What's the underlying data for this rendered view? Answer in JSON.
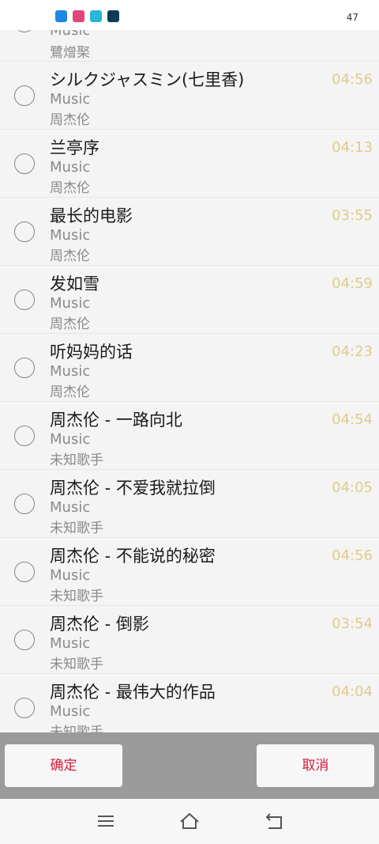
{
  "status_bar": {
    "time": "47",
    "app_icons": [
      {
        "name": "app-blue-arrow",
        "color": "#1e88e5"
      },
      {
        "name": "app-pink",
        "color": "#e0457b"
      },
      {
        "name": "app-cyan",
        "color": "#29b6d8"
      },
      {
        "name": "app-dark-teal",
        "color": "#0d3b57"
      }
    ]
  },
  "songs": [
    {
      "title": "",
      "source": "Music",
      "artist": "鷺熷棸",
      "duration": ""
    },
    {
      "title": "シルクジャスミン(七里香)",
      "source": "Music",
      "artist": "周杰伦",
      "duration": "04:56"
    },
    {
      "title": "兰亭序",
      "source": "Music",
      "artist": "周杰伦",
      "duration": "04:13"
    },
    {
      "title": "最长的电影",
      "source": "Music",
      "artist": "周杰伦",
      "duration": "03:55"
    },
    {
      "title": "发如雪",
      "source": "Music",
      "artist": "周杰伦",
      "duration": "04:59"
    },
    {
      "title": "听妈妈的话",
      "source": "Music",
      "artist": "周杰伦",
      "duration": "04:23"
    },
    {
      "title": "周杰伦 - 一路向北",
      "source": "Music",
      "artist": "未知歌手",
      "duration": "04:54"
    },
    {
      "title": "周杰伦 - 不爱我就拉倒",
      "source": "Music",
      "artist": "未知歌手",
      "duration": "04:05"
    },
    {
      "title": "周杰伦 - 不能说的秘密",
      "source": "Music",
      "artist": "未知歌手",
      "duration": "04:56"
    },
    {
      "title": "周杰伦 - 倒影",
      "source": "Music",
      "artist": "未知歌手",
      "duration": "03:54"
    },
    {
      "title": "周杰伦 - 最伟大的作品",
      "source": "Music",
      "artist": "未知歌手",
      "duration": "04:04"
    }
  ],
  "actions": {
    "confirm_label": "确定",
    "cancel_label": "取消"
  },
  "nav": {
    "icons": [
      "menu-icon",
      "home-icon",
      "back-icon"
    ]
  },
  "colors": {
    "duration": "#e0cc8a",
    "action_text": "#d81b3c"
  }
}
